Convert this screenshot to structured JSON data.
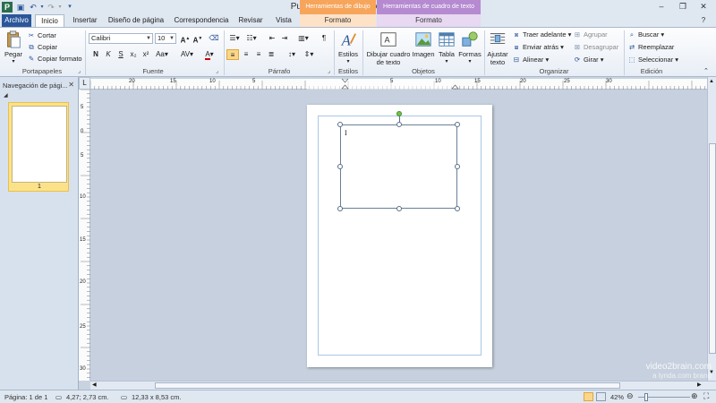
{
  "app": {
    "title": "Publicación1 - Microsoft Publisher",
    "context_tabs": [
      {
        "label": "Herramientas de dibujo",
        "color": "#f6a55a",
        "strip_label": "Formato"
      },
      {
        "label": "Herramientas de cuadro de texto",
        "color": "#b58ad1",
        "strip_label": "Formato"
      }
    ],
    "window_controls": {
      "minimize": "–",
      "restore": "❐",
      "close": "✕"
    }
  },
  "qat": {
    "icons": [
      "publisher-app-icon",
      "save-icon",
      "undo-icon",
      "redo-icon",
      "customize-qat-icon"
    ]
  },
  "tabs": [
    "Archivo",
    "Inicio",
    "Insertar",
    "Diseño de página",
    "Correspondencia",
    "Revisar",
    "Vista"
  ],
  "ribbon": {
    "clipboard": {
      "paste": "Pegar",
      "cut": "Cortar",
      "copy": "Copiar",
      "format_painter": "Copiar formato",
      "label": "Portapapeles"
    },
    "font": {
      "name": "Calibri",
      "size": "10",
      "label": "Fuente"
    },
    "paragraph": {
      "label": "Párrafo"
    },
    "styles": {
      "button": "Estilos",
      "label": "Estilos"
    },
    "objects": {
      "draw_text_box": "Dibujar cuadro de texto",
      "image": "Imagen",
      "table": "Tabla",
      "shapes": "Formas",
      "label": "Objetos"
    },
    "arrange": {
      "wrap_text": "Ajustar texto",
      "bring_forward": "Traer adelante",
      "send_backward": "Enviar atrás",
      "align": "Alinear",
      "group": "Agrupar",
      "ungroup": "Desagrupar",
      "rotate": "Girar",
      "label": "Organizar"
    },
    "editing": {
      "find": "Buscar",
      "replace": "Reemplazar",
      "select": "Seleccionar",
      "label": "Edición"
    }
  },
  "nav_pane": {
    "title": "Navegación de pági...",
    "page_number": "1"
  },
  "rulers": {
    "h_labels": [
      "20",
      "15",
      "10",
      "5",
      "5",
      "10",
      "15",
      "20",
      "25",
      "30"
    ],
    "v_labels": [
      "5",
      "0",
      "5",
      "10",
      "15",
      "20",
      "25",
      "30"
    ]
  },
  "status": {
    "page": "Página: 1 de 1",
    "position": "4,27; 2,73 cm.",
    "size": "12,33 x 8,53 cm.",
    "zoom": "42%"
  },
  "watermark": {
    "line1": "video2brain.com",
    "line2": "a lynda.com brand"
  }
}
